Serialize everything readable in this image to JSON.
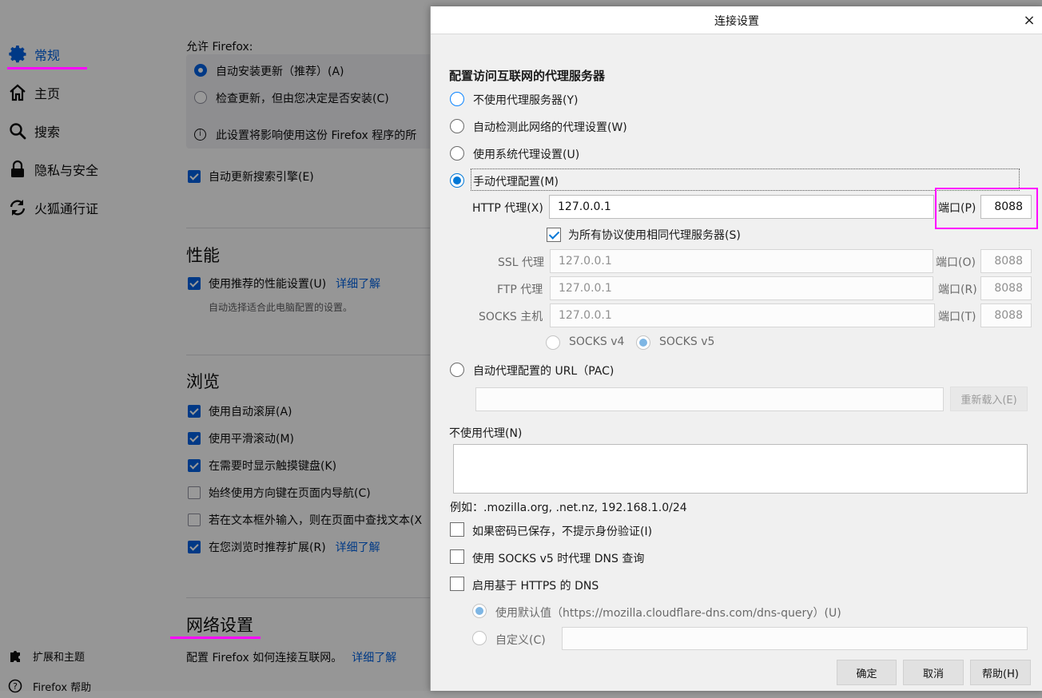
{
  "sidebar": {
    "items": [
      {
        "label": "常规",
        "icon": "gear-icon"
      },
      {
        "label": "主页",
        "icon": "home-icon"
      },
      {
        "label": "搜索",
        "icon": "search-icon"
      },
      {
        "label": "隐私与安全",
        "icon": "lock-icon"
      },
      {
        "label": "火狐通行证",
        "icon": "sync-icon"
      }
    ],
    "bottom": [
      {
        "label": "扩展和主题",
        "icon": "puzzle-icon"
      },
      {
        "label": "Firefox 帮助",
        "icon": "help-icon"
      }
    ],
    "active_color": "#0060df"
  },
  "background": {
    "allow_text": "允许 Firefox:",
    "update_auto": "自动安装更新（推荐）(A)",
    "update_check": "检查更新，但由您决定是否安装(C)",
    "update_note": "此设置将影响使用这份 Firefox 程序的所",
    "search_engine_update": "自动更新搜索引擎(E)",
    "performance_heading": "性能",
    "perf_recommended": "使用推荐的性能设置(U)",
    "perf_learn_more": "详细了解",
    "perf_sub": "自动选择适合此电脑配置的设置。",
    "browsing_heading": "浏览",
    "browsing": [
      {
        "label": "使用自动滚屏(A)",
        "checked": true
      },
      {
        "label": "使用平滑滚动(M)",
        "checked": true
      },
      {
        "label": "在需要时显示触摸键盘(K)",
        "checked": true
      },
      {
        "label": "始终使用方向键在页面内导航(C)",
        "checked": false
      },
      {
        "label": "若在文本框外输入，则在页面中查找文本(X",
        "checked": false
      }
    ],
    "recommend_ext": "在您浏览时推荐扩展(R)",
    "recommend_learn_more": "详细了解",
    "network_heading": "网络设置",
    "network_desc": "配置 Firefox 如何连接互联网。",
    "network_learn_more": "详细了解"
  },
  "dialog": {
    "title": "连接设置",
    "close": "×",
    "heading": "配置访问互联网的代理服务器",
    "options": {
      "no_proxy": "不使用代理服务器(Y)",
      "auto_detect": "自动检测此网络的代理设置(W)",
      "system": "使用系统代理设置(U)",
      "manual": "手动代理配置(M)",
      "pac": "自动代理配置的 URL（PAC)"
    },
    "http_label": "HTTP 代理(X)",
    "http_value": "127.0.0.1",
    "port_label_p": "端口(P)",
    "http_port": "8088",
    "same_proxy": "为所有协议使用相同代理服务器(S)",
    "ssl_label": "SSL 代理",
    "ssl_value": "127.0.0.1",
    "port_label_o": "端口(O)",
    "ssl_port": "8088",
    "ftp_label": "FTP 代理",
    "ftp_value": "127.0.0.1",
    "port_label_r": "端口(R)",
    "ftp_port": "8088",
    "socks_label": "SOCKS 主机",
    "socks_value": "127.0.0.1",
    "port_label_t": "端口(T)",
    "socks_port": "8088",
    "socks_v4": "SOCKS v4",
    "socks_v5": "SOCKS v5",
    "pac_url": "",
    "reload": "重新载入(E)",
    "no_proxy_for": "不使用代理(N)",
    "no_proxy_value": "",
    "example": "例如：.mozilla.org, .net.nz, 192.168.1.0/24",
    "no_auth_prompt": "如果密码已保存，不提示身份验证(I)",
    "socks_dns": "使用 SOCKS v5 时代理 DNS 查询",
    "https_dns": "启用基于 HTTPS 的 DNS",
    "dns_default": "使用默认值（https://mozilla.cloudflare-dns.com/dns-query）(U)",
    "dns_custom": "自定义(C)",
    "dns_custom_value": "",
    "ok": "确定",
    "cancel": "取消",
    "help": "帮助(H)"
  },
  "colors": {
    "accent": "#0078d7",
    "highlight": "#ff00ff"
  }
}
